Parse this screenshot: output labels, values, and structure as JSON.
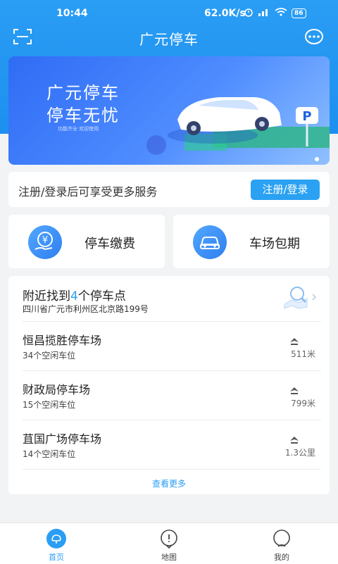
{
  "status_bar": {
    "time": "10:44",
    "net_speed": "62.0K/s",
    "battery": "86"
  },
  "nav": {
    "title": "广元停车",
    "scan_icon": "scan-icon",
    "more_icon": "more-icon"
  },
  "banner": {
    "line1": "广元停车",
    "line2": "停车无忧",
    "sub": "功能齐全  欢迎使用"
  },
  "login": {
    "text": "注册/登录后可享受更多服务",
    "button": "注册/登录"
  },
  "services": [
    {
      "label": "停车缴费",
      "icon": "yuan-payment-icon"
    },
    {
      "label": "车场包期",
      "icon": "car-icon"
    }
  ],
  "nearby": {
    "title_prefix": "附近找到",
    "count": "4",
    "title_suffix": "个停车点",
    "address": "四川省广元市利州区北京路199号",
    "lots": [
      {
        "name": "恒昌揽胜停车场",
        "free": "34个空闲车位",
        "distance": "511米"
      },
      {
        "name": "财政局停车场",
        "free": "15个空闲车位",
        "distance": "799米"
      },
      {
        "name": "苴国广场停车场",
        "free": "14个空闲车位",
        "distance": "1.3公里"
      }
    ],
    "see_more": "查看更多"
  },
  "tabs": [
    {
      "label": "首页",
      "icon": "home-icon",
      "active": true
    },
    {
      "label": "地图",
      "icon": "map-pin-icon",
      "active": false
    },
    {
      "label": "我的",
      "icon": "profile-icon",
      "active": false
    }
  ],
  "colors": {
    "primary": "#2a9df4",
    "button": "#2aa1f2"
  }
}
